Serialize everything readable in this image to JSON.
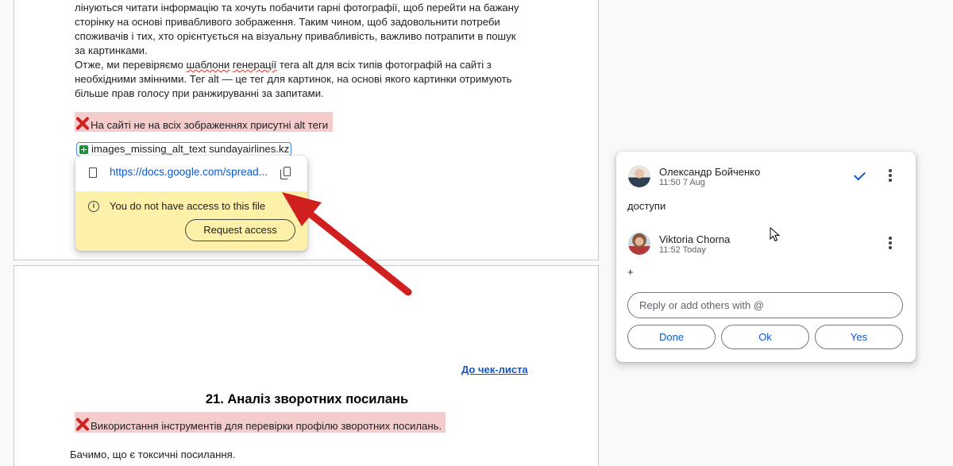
{
  "document": {
    "paragraph_lines": [
      "лінуються читати інформацію та хочуть побачити гарні фотографії, щоб перейти на бажану",
      "сторінку на основі привабливого зображення. Таким чином, щоб задовольнити потреби",
      "споживачів і тих, хто орієнтується на візуальну привабливість, важливо потрапити в пошук",
      "за картинками."
    ],
    "para2_prefix": "Отже, ми перевіряємо ",
    "para2_w1": "шаблони",
    "para2_mid": " ",
    "para2_w2": "генерації",
    "para2_suffix": " тега alt для всіх типів фотографій на сайті з",
    "para2_line2": "необхідними змінними. Тег alt — це тег для картинок, на основі якого картинки отримують",
    "para2_line3": "більше прав голосу при ранжируванні за запитами.",
    "issue_missing_alt": "На сайті не на всіх зображеннях присутні alt теги",
    "file_chip": "images_missing_alt_text sundayairlines.kz",
    "checklist_link": "До чек-листа",
    "section_title": "21. Аналіз зворотних посилань",
    "issue_backlinks": "Використання інструментів для перевірки профілю зворотних посилань.",
    "toxic_links": "Бачимо, що є токсичні посилання."
  },
  "link_popup": {
    "url": "https://docs.google.com/spread...",
    "no_access_text": "You do not have access to this file",
    "request_button": "Request access"
  },
  "comment_thread": {
    "comments": [
      {
        "author": "Олександр Бойченко",
        "time": "11:50 7 Aug",
        "text": "доступи"
      },
      {
        "author": "Viktoria Chorna",
        "time": "11:52 Today",
        "text": "+"
      }
    ],
    "reply_placeholder": "Reply or add others with @",
    "quick_replies": [
      "Done",
      "Ok",
      "Yes"
    ]
  },
  "colors": {
    "issue_highlight": "#f4cccc",
    "arrow": "#d01f1f",
    "popup_warning_bg": "#fdf0a8",
    "accent_blue": "#0b57d0"
  },
  "icons": [
    "red-x-icon",
    "sheets-icon",
    "doc-icon",
    "copy-icon",
    "info-icon",
    "resolve-check-icon",
    "more-vert-icon",
    "mouse-cursor-icon"
  ]
}
